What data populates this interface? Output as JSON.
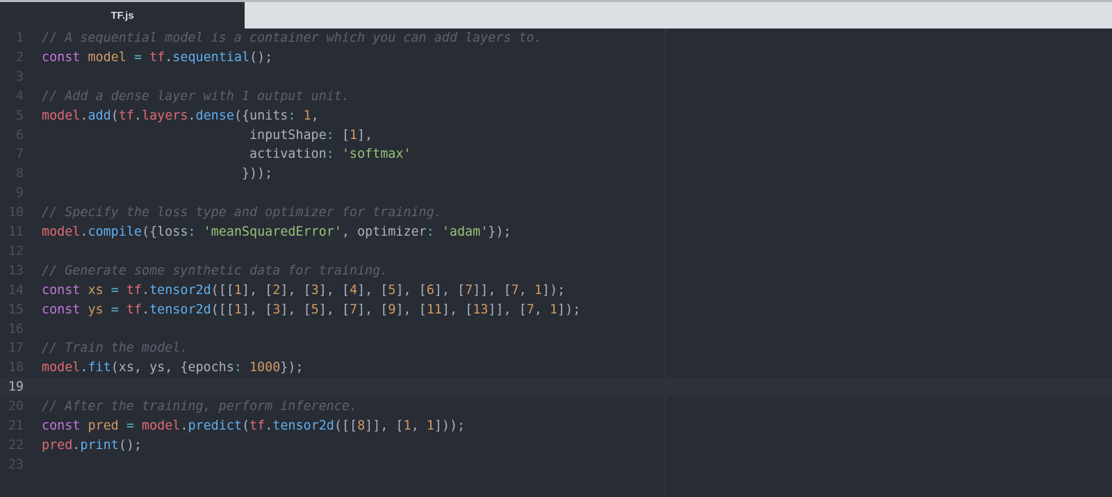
{
  "tab": {
    "title": "TF.js"
  },
  "current_line": 19,
  "code": {
    "lines": [
      [
        [
          "c",
          "// A sequential model is a container which you can add layers to."
        ]
      ],
      [
        [
          "k",
          "const"
        ],
        [
          "p",
          " "
        ],
        [
          "v",
          "model"
        ],
        [
          "p",
          " "
        ],
        [
          "o",
          "="
        ],
        [
          "p",
          " "
        ],
        [
          "t",
          "tf"
        ],
        [
          "p",
          "."
        ],
        [
          "f",
          "sequential"
        ],
        [
          "p",
          "();"
        ]
      ],
      [],
      [
        [
          "c",
          "// Add a dense layer with 1 output unit."
        ]
      ],
      [
        [
          "t",
          "model"
        ],
        [
          "p",
          "."
        ],
        [
          "f",
          "add"
        ],
        [
          "p",
          "("
        ],
        [
          "t",
          "tf"
        ],
        [
          "p",
          "."
        ],
        [
          "t",
          "layers"
        ],
        [
          "p",
          "."
        ],
        [
          "f",
          "dense"
        ],
        [
          "p",
          "({units"
        ],
        [
          "o",
          ":"
        ],
        [
          "p",
          " "
        ],
        [
          "n",
          "1"
        ],
        [
          "p",
          ","
        ]
      ],
      [
        [
          "p",
          "                           inputShape"
        ],
        [
          "o",
          ":"
        ],
        [
          "p",
          " ["
        ],
        [
          "n",
          "1"
        ],
        [
          "p",
          "],"
        ]
      ],
      [
        [
          "p",
          "                           activation"
        ],
        [
          "o",
          ":"
        ],
        [
          "p",
          " "
        ],
        [
          "s",
          "'softmax'"
        ]
      ],
      [
        [
          "p",
          "                          }));"
        ]
      ],
      [],
      [
        [
          "c",
          "// Specify the loss type and optimizer for training."
        ]
      ],
      [
        [
          "t",
          "model"
        ],
        [
          "p",
          "."
        ],
        [
          "f",
          "compile"
        ],
        [
          "p",
          "({loss"
        ],
        [
          "o",
          ":"
        ],
        [
          "p",
          " "
        ],
        [
          "s",
          "'meanSquaredError'"
        ],
        [
          "p",
          ", optimizer"
        ],
        [
          "o",
          ":"
        ],
        [
          "p",
          " "
        ],
        [
          "s",
          "'adam'"
        ],
        [
          "p",
          "});"
        ]
      ],
      [],
      [
        [
          "c",
          "// Generate some synthetic data for training."
        ]
      ],
      [
        [
          "k",
          "const"
        ],
        [
          "p",
          " "
        ],
        [
          "v",
          "xs"
        ],
        [
          "p",
          " "
        ],
        [
          "o",
          "="
        ],
        [
          "p",
          " "
        ],
        [
          "t",
          "tf"
        ],
        [
          "p",
          "."
        ],
        [
          "f",
          "tensor2d"
        ],
        [
          "p",
          "([["
        ],
        [
          "n",
          "1"
        ],
        [
          "p",
          "], ["
        ],
        [
          "n",
          "2"
        ],
        [
          "p",
          "], ["
        ],
        [
          "n",
          "3"
        ],
        [
          "p",
          "], ["
        ],
        [
          "n",
          "4"
        ],
        [
          "p",
          "], ["
        ],
        [
          "n",
          "5"
        ],
        [
          "p",
          "], ["
        ],
        [
          "n",
          "6"
        ],
        [
          "p",
          "], ["
        ],
        [
          "n",
          "7"
        ],
        [
          "p",
          "]], ["
        ],
        [
          "n",
          "7"
        ],
        [
          "p",
          ", "
        ],
        [
          "n",
          "1"
        ],
        [
          "p",
          "]);"
        ]
      ],
      [
        [
          "k",
          "const"
        ],
        [
          "p",
          " "
        ],
        [
          "v",
          "ys"
        ],
        [
          "p",
          " "
        ],
        [
          "o",
          "="
        ],
        [
          "p",
          " "
        ],
        [
          "t",
          "tf"
        ],
        [
          "p",
          "."
        ],
        [
          "f",
          "tensor2d"
        ],
        [
          "p",
          "([["
        ],
        [
          "n",
          "1"
        ],
        [
          "p",
          "], ["
        ],
        [
          "n",
          "3"
        ],
        [
          "p",
          "], ["
        ],
        [
          "n",
          "5"
        ],
        [
          "p",
          "], ["
        ],
        [
          "n",
          "7"
        ],
        [
          "p",
          "], ["
        ],
        [
          "n",
          "9"
        ],
        [
          "p",
          "], ["
        ],
        [
          "n",
          "11"
        ],
        [
          "p",
          "], ["
        ],
        [
          "n",
          "13"
        ],
        [
          "p",
          "]], ["
        ],
        [
          "n",
          "7"
        ],
        [
          "p",
          ", "
        ],
        [
          "n",
          "1"
        ],
        [
          "p",
          "]);"
        ]
      ],
      [],
      [
        [
          "c",
          "// Train the model."
        ]
      ],
      [
        [
          "t",
          "model"
        ],
        [
          "p",
          "."
        ],
        [
          "f",
          "fit"
        ],
        [
          "p",
          "(xs, ys, {epochs"
        ],
        [
          "o",
          ":"
        ],
        [
          "p",
          " "
        ],
        [
          "n",
          "1000"
        ],
        [
          "p",
          "});"
        ]
      ],
      [],
      [
        [
          "c",
          "// After the training, perform inference."
        ]
      ],
      [
        [
          "k",
          "const"
        ],
        [
          "p",
          " "
        ],
        [
          "v",
          "pred"
        ],
        [
          "p",
          " "
        ],
        [
          "o",
          "="
        ],
        [
          "p",
          " "
        ],
        [
          "t",
          "model"
        ],
        [
          "p",
          "."
        ],
        [
          "f",
          "predict"
        ],
        [
          "p",
          "("
        ],
        [
          "t",
          "tf"
        ],
        [
          "p",
          "."
        ],
        [
          "f",
          "tensor2d"
        ],
        [
          "p",
          "([["
        ],
        [
          "n",
          "8"
        ],
        [
          "p",
          "]], ["
        ],
        [
          "n",
          "1"
        ],
        [
          "p",
          ", "
        ],
        [
          "n",
          "1"
        ],
        [
          "p",
          "]));"
        ]
      ],
      [
        [
          "t",
          "pred"
        ],
        [
          "p",
          "."
        ],
        [
          "f",
          "print"
        ],
        [
          "p",
          "();"
        ]
      ],
      []
    ]
  }
}
